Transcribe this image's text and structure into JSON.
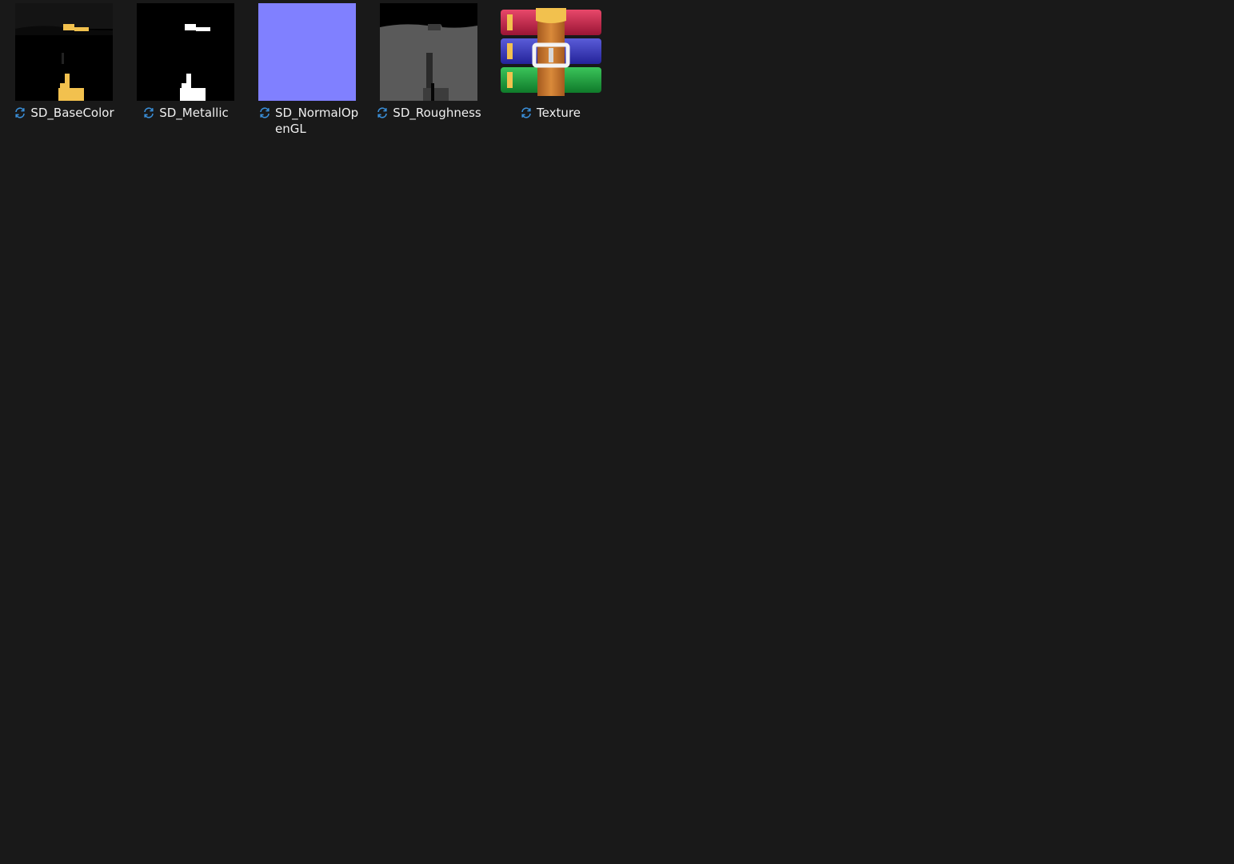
{
  "window": {
    "background": "#191919"
  },
  "files": [
    {
      "name": "SD_BaseColor",
      "type": "image",
      "icon": "basecolor-thumbnail",
      "status_icon": "sync-pending-icon"
    },
    {
      "name": "SD_Metallic",
      "type": "image",
      "icon": "metallic-thumbnail",
      "status_icon": "sync-pending-icon"
    },
    {
      "name_line1": "SD_NormalOp",
      "name_line2": "enGL",
      "type": "image",
      "icon": "normal-map-thumbnail",
      "status_icon": "sync-pending-icon",
      "thumb_color": "#8080ff"
    },
    {
      "name": "SD_Roughness",
      "type": "image",
      "icon": "roughness-thumbnail",
      "status_icon": "sync-pending-icon"
    },
    {
      "name": "Texture",
      "type": "archive",
      "icon": "winrar-archive-icon",
      "status_icon": "sync-pending-icon"
    }
  ],
  "colors": {
    "label_text": "#f0f0f0",
    "sync_icon": "#3a8fd9",
    "basecolor_accent": "#f2c14e"
  }
}
